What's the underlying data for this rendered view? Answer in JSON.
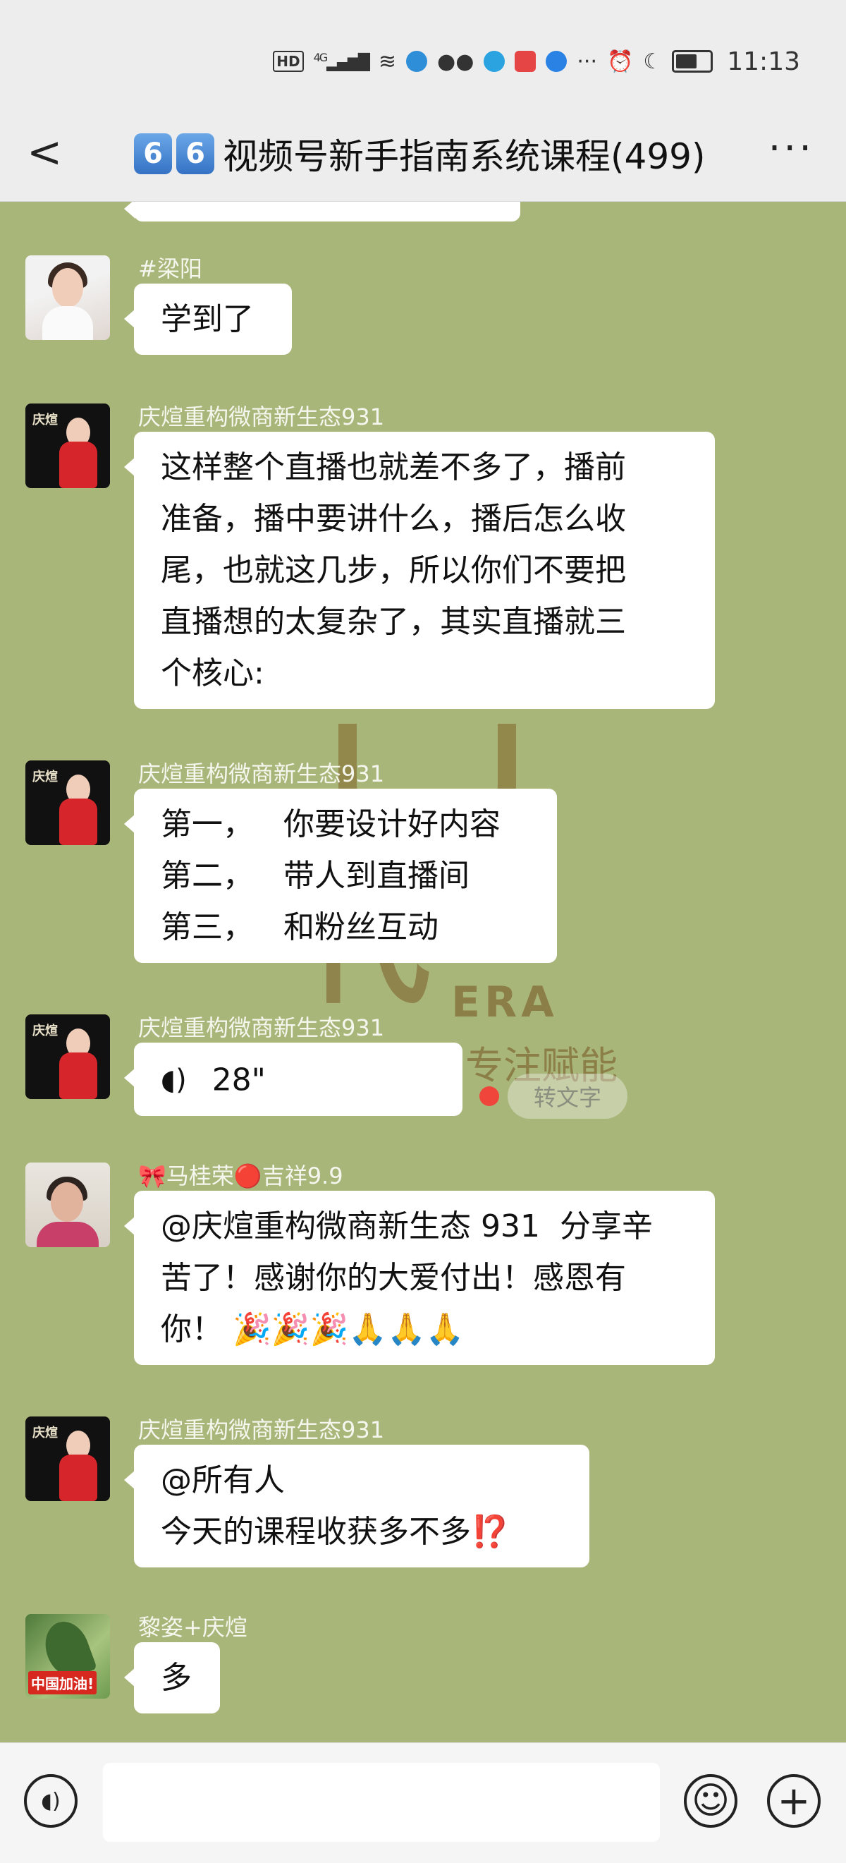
{
  "status_bar": {
    "time": "11:13",
    "icons": [
      "hd-icon",
      "signal-icon",
      "wifi-icon",
      "app-icon",
      "wechat-icon",
      "app-icon",
      "app-icon",
      "app-icon",
      "more-icon",
      "alarm-icon",
      "moon-icon",
      "battery-icon"
    ],
    "hd_label": "HD",
    "signal_label": "4G",
    "more_label": "···"
  },
  "header": {
    "back_label": "<",
    "title_keycaps": [
      "6",
      "6"
    ],
    "title": "视频号新手指南系统课程(499)",
    "more_label": "···"
  },
  "messages": [
    {
      "name": "#梁阳",
      "lines": [
        "学到了"
      ],
      "avatar": "avatar-liang"
    },
    {
      "name": "庆煊重构微商新生态931",
      "lines": [
        "这样整个直播也就差不多了，播前",
        "准备，播中要讲什么，播后怎么收",
        "尾，也就这几步，所以你们不要把",
        "直播想的太复杂了，其实直播就三",
        "个核心:"
      ],
      "avatar": "avatar-qingxuan"
    },
    {
      "name": "庆煊重构微商新生态931",
      "lines": [
        "第一，   你要设计好内容",
        "第二，   带人到直播间",
        "第三，   和粉丝互动"
      ],
      "avatar": "avatar-qingxuan"
    },
    {
      "name": "庆煊重构微商新生态931",
      "voice_duration": "28\"",
      "avatar": "avatar-qingxuan"
    },
    {
      "name": "🎀马桂荣🔴吉祥9.9",
      "lines": [
        "@庆煊重构微商新生态 931  分享辛",
        "苦了！感谢你的大爱付出！感恩有",
        "你！ 🎉🎉🎉🙏🙏🙏"
      ],
      "avatar": "avatar-ma"
    },
    {
      "name": "庆煊重构微商新生态931",
      "lines": [
        "@所有人",
        "今天的课程收获多不多⁉️"
      ],
      "avatar": "avatar-qingxuan"
    },
    {
      "name": "黎姿+庆煊",
      "lines": [
        "多"
      ],
      "avatar": "avatar-li"
    }
  ],
  "avatar_text": {
    "qingxuan": "庆煊",
    "li_tag": "中国加油!"
  },
  "watermark": {
    "big": "代",
    "era": "ERA",
    "sub": "专注赋能"
  },
  "voice": {
    "to_text_label": "转文字",
    "icon": "voice-wave-icon"
  },
  "input_bar": {
    "voice_icon_label": "◖)",
    "emoji_icon_label": "☺",
    "plus_icon_label": "+"
  }
}
